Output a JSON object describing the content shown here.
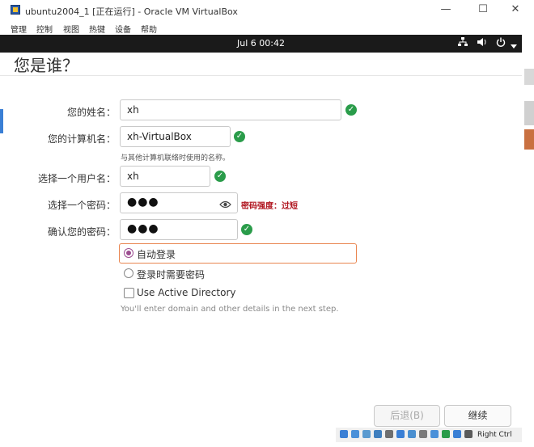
{
  "window": {
    "title": "ubuntu2004_1 [正在运行] - Oracle VM VirtualBox",
    "minimize": "—",
    "maximize": "☐",
    "close": "✕"
  },
  "menubar": {
    "items": [
      "管理",
      "控制",
      "视图",
      "热键",
      "设备",
      "帮助"
    ]
  },
  "topbar": {
    "clock": "Jul 6  00:42",
    "icons": [
      "network-icon",
      "volume-icon",
      "power-icon",
      "menu-arrow-icon"
    ]
  },
  "page": {
    "title": "您是谁？"
  },
  "form": {
    "name_label": "您的姓名：",
    "name_value": "xh",
    "computer_label": "您的计算机名：",
    "computer_value": "xh-VirtualBox",
    "computer_hint": "与其他计算机联络时使用的名称。",
    "username_label": "选择一个用户名：",
    "username_value": "xh",
    "password_label": "选择一个密码：",
    "password_value": "●●●",
    "password_strength": "密码强度：过短",
    "confirm_label": "确认您的密码：",
    "confirm_value": "●●●"
  },
  "login_options": {
    "auto_login": "自动登录",
    "require_password": "登录时需要密码",
    "selected": "auto_login",
    "active_directory": "Use Active Directory",
    "active_directory_checked": false,
    "ad_note": "You'll enter domain and other details in the next step."
  },
  "buttons": {
    "back": "后退(B)",
    "continue": "继续"
  },
  "statusbar": {
    "host_key": "Right Ctrl"
  },
  "colors": {
    "ok_green": "#2a9c4a",
    "strength_red": "#b0141e",
    "radio_purple": "#9c4d90",
    "focus_orange": "#e9854f",
    "topbar": "#1a1a1a"
  }
}
